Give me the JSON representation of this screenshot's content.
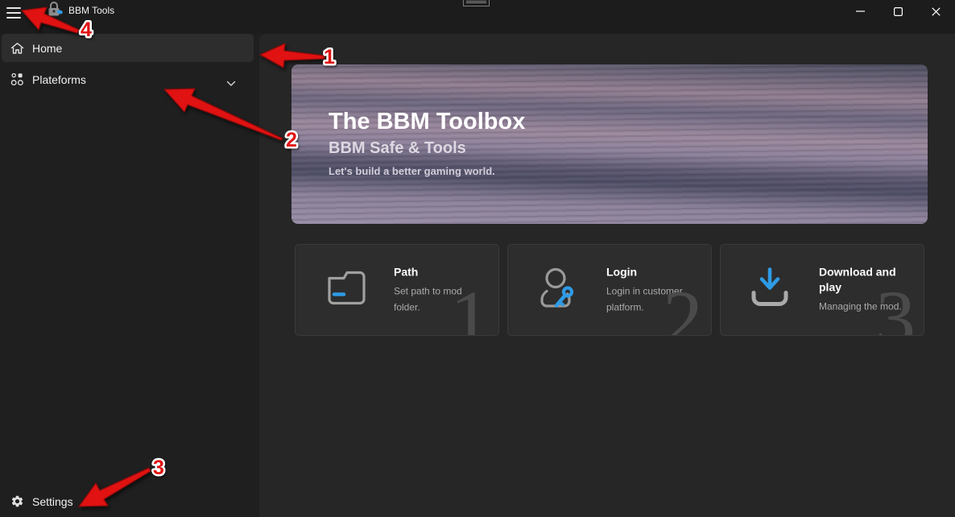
{
  "window": {
    "title": "BBM Tools"
  },
  "sidebar": {
    "items": [
      {
        "label": "Home",
        "active": true
      },
      {
        "label": "Plateforms",
        "expandable": true
      },
      {
        "label": "Settings"
      }
    ]
  },
  "hero": {
    "title": "The BBM Toolbox",
    "subtitle": "BBM Safe & Tools",
    "tagline": "Let's build a better gaming world."
  },
  "cards": [
    {
      "title": "Path",
      "description": "Set path to mod folder.",
      "step_number": "1",
      "icon": "folder-icon"
    },
    {
      "title": "Login",
      "description": "Login in customer platform.",
      "step_number": "2",
      "icon": "user-key-icon"
    },
    {
      "title": "Download and play",
      "description": "Managing the mod.",
      "step_number": "3",
      "icon": "download-icon"
    }
  ],
  "annotations": [
    {
      "label": "1",
      "points_to": "home-sidebar-item"
    },
    {
      "label": "2",
      "points_to": "plateforms-sidebar-item"
    },
    {
      "label": "3",
      "points_to": "settings-sidebar-item"
    },
    {
      "label": "4",
      "points_to": "hamburger-menu-button"
    }
  ],
  "icons": {
    "titlebar": [
      "hamburger-menu-icon",
      "app-lock-icon",
      "snap-indicator-icon",
      "minimize-icon",
      "maximize-icon",
      "close-icon"
    ],
    "sidebar": [
      "home-icon",
      "category-icon",
      "chevron-down-icon",
      "gear-icon"
    ],
    "cards": [
      "folder-icon",
      "user-key-icon",
      "download-icon"
    ]
  },
  "colors": {
    "accent_blue": "#2e9be5",
    "annotation_red": "#e01212",
    "sidebar_bg": "#1f1f1f",
    "content_bg": "#262626",
    "card_bg": "#2d2d2d"
  }
}
